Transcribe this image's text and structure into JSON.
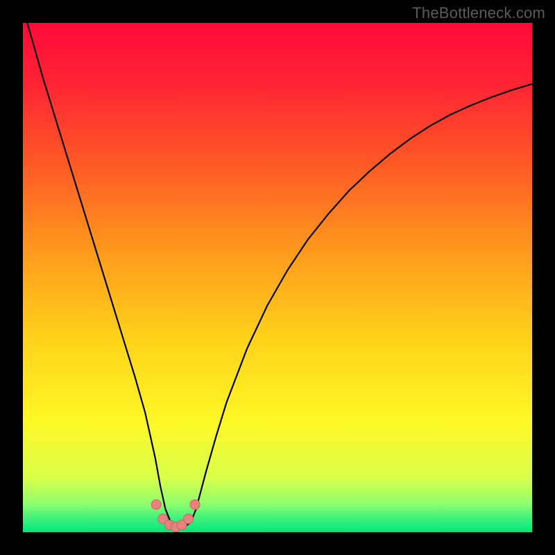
{
  "watermark": {
    "text": "TheBottleneck.com"
  },
  "colors": {
    "gradient_stops": [
      {
        "offset": 0.0,
        "color": "#ff0a3a"
      },
      {
        "offset": 0.12,
        "color": "#ff2433"
      },
      {
        "offset": 0.28,
        "color": "#ff5a26"
      },
      {
        "offset": 0.45,
        "color": "#ff9a1c"
      },
      {
        "offset": 0.62,
        "color": "#ffd21a"
      },
      {
        "offset": 0.78,
        "color": "#fff725"
      },
      {
        "offset": 0.895,
        "color": "#d7ff4a"
      },
      {
        "offset": 0.945,
        "color": "#8dff6e"
      },
      {
        "offset": 0.975,
        "color": "#3af07e"
      },
      {
        "offset": 1.0,
        "color": "#00e77a"
      }
    ],
    "curve": "#000000",
    "markers_fill": "#e9817f",
    "markers_stroke": "#c86560",
    "frame_border": "#000000"
  },
  "chart_data": {
    "type": "line",
    "title": "",
    "xlabel": "",
    "ylabel": "",
    "xlim": [
      0,
      100
    ],
    "ylim": [
      0,
      100
    ],
    "grid": false,
    "legend": false,
    "series": [
      {
        "name": "bottleneck-curve",
        "x": [
          0,
          2,
          4,
          6,
          8,
          10,
          12,
          14,
          16,
          18,
          20,
          22,
          24,
          26,
          27,
          28,
          29,
          30,
          31,
          32,
          33,
          34,
          36,
          38,
          40,
          44,
          48,
          52,
          56,
          60,
          64,
          68,
          72,
          76,
          80,
          84,
          88,
          92,
          96,
          100
        ],
        "y": [
          103,
          96,
          89,
          82.5,
          76,
          69.5,
          63,
          56.5,
          50,
          43.5,
          37,
          30.5,
          23.5,
          14.5,
          9.0,
          4.5,
          2.0,
          1.2,
          1.0,
          1.2,
          2.0,
          4.5,
          12.0,
          19.0,
          25.5,
          36.0,
          44.5,
          51.5,
          57.5,
          62.5,
          67.0,
          70.8,
          74.2,
          77.2,
          79.8,
          82.0,
          83.8,
          85.4,
          86.8,
          88.0
        ]
      }
    ],
    "markers": {
      "name": "optimum-points",
      "x": [
        26.2,
        27.5,
        28.8,
        30.0,
        31.2,
        32.5,
        33.8
      ],
      "y": [
        5.4,
        2.6,
        1.4,
        1.0,
        1.4,
        2.6,
        5.4
      ]
    }
  }
}
